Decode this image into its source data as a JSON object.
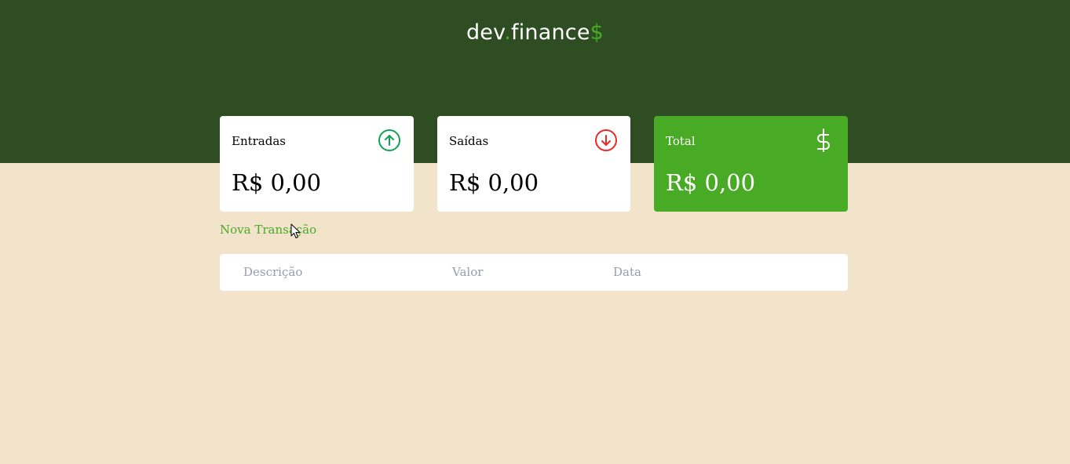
{
  "header": {
    "logo_prefix": "dev",
    "logo_dot": ".",
    "logo_name": "finance",
    "logo_suffix": "$"
  },
  "cards": [
    {
      "label": "Entradas",
      "value": "R$ 0,00",
      "icon": "arrow-up-circle-icon",
      "icon_color": "#12a454"
    },
    {
      "label": "Saídas",
      "value": "R$ 0,00",
      "icon": "arrow-down-circle-icon",
      "icon_color": "#e92929"
    },
    {
      "label": "Total",
      "value": "R$ 0,00",
      "icon": "dollar-icon",
      "icon_color": "#ffffff"
    }
  ],
  "new_transaction_label": "Nova Transação",
  "table": {
    "columns": [
      "Descrição",
      "Valor",
      "Data"
    ],
    "rows": []
  },
  "colors": {
    "header_bg": "#2e4d22",
    "body_bg": "#f2e4cb",
    "accent": "#49aa26",
    "table_header_text": "#969cb3"
  }
}
